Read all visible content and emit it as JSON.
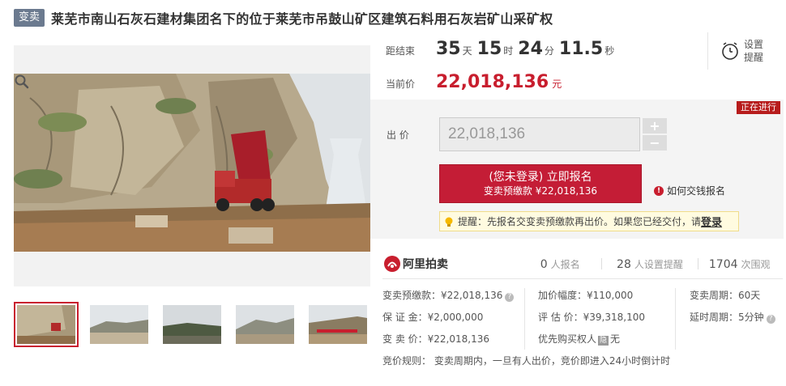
{
  "title": {
    "badge": "变卖",
    "text": "莱芜市南山石灰石建材集团名下的位于莱芜市吊鼓山矿区建筑石料用石灰岩矿山采矿权"
  },
  "timer": {
    "label": "距结束",
    "days": "35",
    "days_unit": "天",
    "hours": "15",
    "hours_unit": "时",
    "minutes": "24",
    "minutes_unit": "分",
    "seconds": "11.5",
    "seconds_unit": "秒"
  },
  "reminder": {
    "label": "设置提醒",
    "icon": "alarm-clock-icon"
  },
  "current_price": {
    "label": "当前价",
    "value": "22,018,136",
    "unit": "元"
  },
  "status_tag": "正在进行",
  "bid": {
    "label": "出  价",
    "value": "22,018,136",
    "plus": "+",
    "minus": "−"
  },
  "cta": {
    "line1": "(您未登录) 立即报名",
    "line2": "变卖预缴款 ¥22,018,136"
  },
  "how_to_pay": {
    "icon": "info-icon",
    "text": "如何交钱报名"
  },
  "tip": {
    "icon": "lightbulb-icon",
    "text": "提醒：先报名交变卖预缴款再出价。如果您已经交付，请",
    "login": "登录"
  },
  "brand": {
    "name": "阿里拍卖"
  },
  "stats": [
    {
      "num": "0",
      "text": "人报名"
    },
    {
      "num": "28",
      "text": "人设置提醒"
    },
    {
      "num": "1704",
      "text": "次围观"
    }
  ],
  "info": {
    "col1": [
      "变卖预缴款：¥22,018,136",
      "保 证 金：¥2,000,000",
      "变 卖 价：¥22,018,136"
    ],
    "col2": [
      "加价幅度：¥110,000",
      "评 估 价：¥39,318,100",
      "优先购买权人",
      "无"
    ],
    "col3": [
      "变卖周期：60天",
      "延时周期：5分钟"
    ],
    "yin_badge": "隐",
    "rules": "竞价规则： 变卖周期内，一旦有人出价，竞价即进入24小时倒计时"
  },
  "colors": {
    "accent": "#c41d36",
    "badge": "#6b7a8f"
  }
}
